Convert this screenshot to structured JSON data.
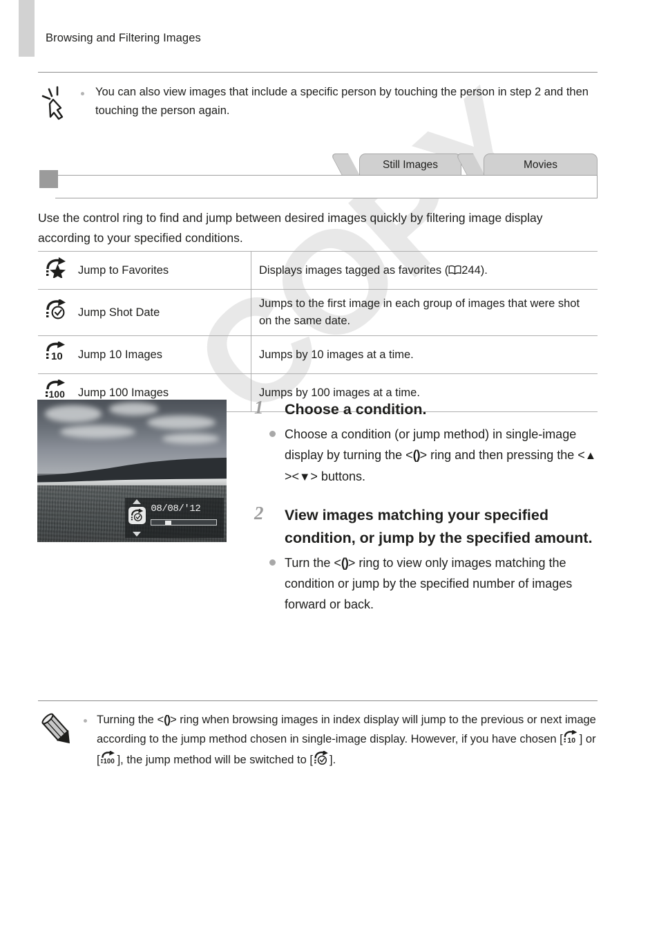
{
  "page": {
    "running_header": "Browsing and Filtering Images",
    "watermark": "COPY",
    "chapter_tab_color": "#d2d2d2"
  },
  "tip_block": {
    "icon": "touch-hand-icon",
    "text": "You can also view images that include a specific person by touching the person in step 2 and then touching the person again."
  },
  "tabs": [
    {
      "label": "Still Images"
    },
    {
      "label": "Movies"
    }
  ],
  "section": {
    "marker": "section-marker-square",
    "title": ""
  },
  "intro": "Use the control ring to find and jump between desired images quickly by filtering image display according to your specified conditions.",
  "methods_table": {
    "rows": [
      {
        "icon": "jump-to-favorites-icon",
        "label": "Jump to Favorites",
        "desc_before": "Displays images tagged as favorites (",
        "ref_icon": "book-reference-icon",
        "ref_page": "244",
        "desc_after": ")."
      },
      {
        "icon": "jump-shot-date-icon",
        "label": "Jump Shot Date",
        "desc_before": "Jumps to the first image in each group of images that were shot on the same date.",
        "ref_icon": "",
        "ref_page": "",
        "desc_after": ""
      },
      {
        "icon": "jump-10-images-icon",
        "label": "Jump 10 Images",
        "desc_before": "Jumps by 10 images at a time.",
        "ref_icon": "",
        "ref_page": "",
        "desc_after": ""
      },
      {
        "icon": "jump-100-images-icon",
        "label": "Jump 100 Images",
        "desc_before": "Jumps by 100 images at a time.",
        "ref_icon": "",
        "ref_page": "",
        "desc_after": ""
      }
    ]
  },
  "camera_screen": {
    "osd_icon": "jump-shot-date-icon",
    "date_value": "08/08/'12",
    "slider_position_pct": 21,
    "up_arrow": "triangle-up-icon",
    "down_arrow": "triangle-down-icon"
  },
  "steps": [
    {
      "number": "1",
      "heading": "Choose a condition.",
      "body_parts": {
        "p1": "Choose a condition (or jump method) in single-image display by turning the <",
        "ring": "()",
        "p2": "> ring and then pressing the <",
        "key_up": "▲",
        "p3": "><",
        "key_down": "▼",
        "p4": "> buttons."
      }
    },
    {
      "number": "2",
      "heading": "View images matching your specified condition, or jump by the specified amount.",
      "body_parts": {
        "p1": "Turn the <",
        "ring": "()",
        "p2": "> ring to view only images matching the condition or jump by the specified number of images forward or back."
      }
    }
  ],
  "note_block": {
    "icon": "pencil-icon",
    "parts": {
      "t1": "Turning the <",
      "ring": "()",
      "t2": "> ring when browsing images in index display will jump to the previous or next image according to the jump method chosen in single-image display. However, if you have chosen [",
      "icon_10": "jump-10-images-icon",
      "t3": "] or [",
      "icon_100": "jump-100-images-icon",
      "t4": "], the jump method will be switched to [",
      "icon_date": "jump-shot-date-icon",
      "t5": "]."
    }
  }
}
